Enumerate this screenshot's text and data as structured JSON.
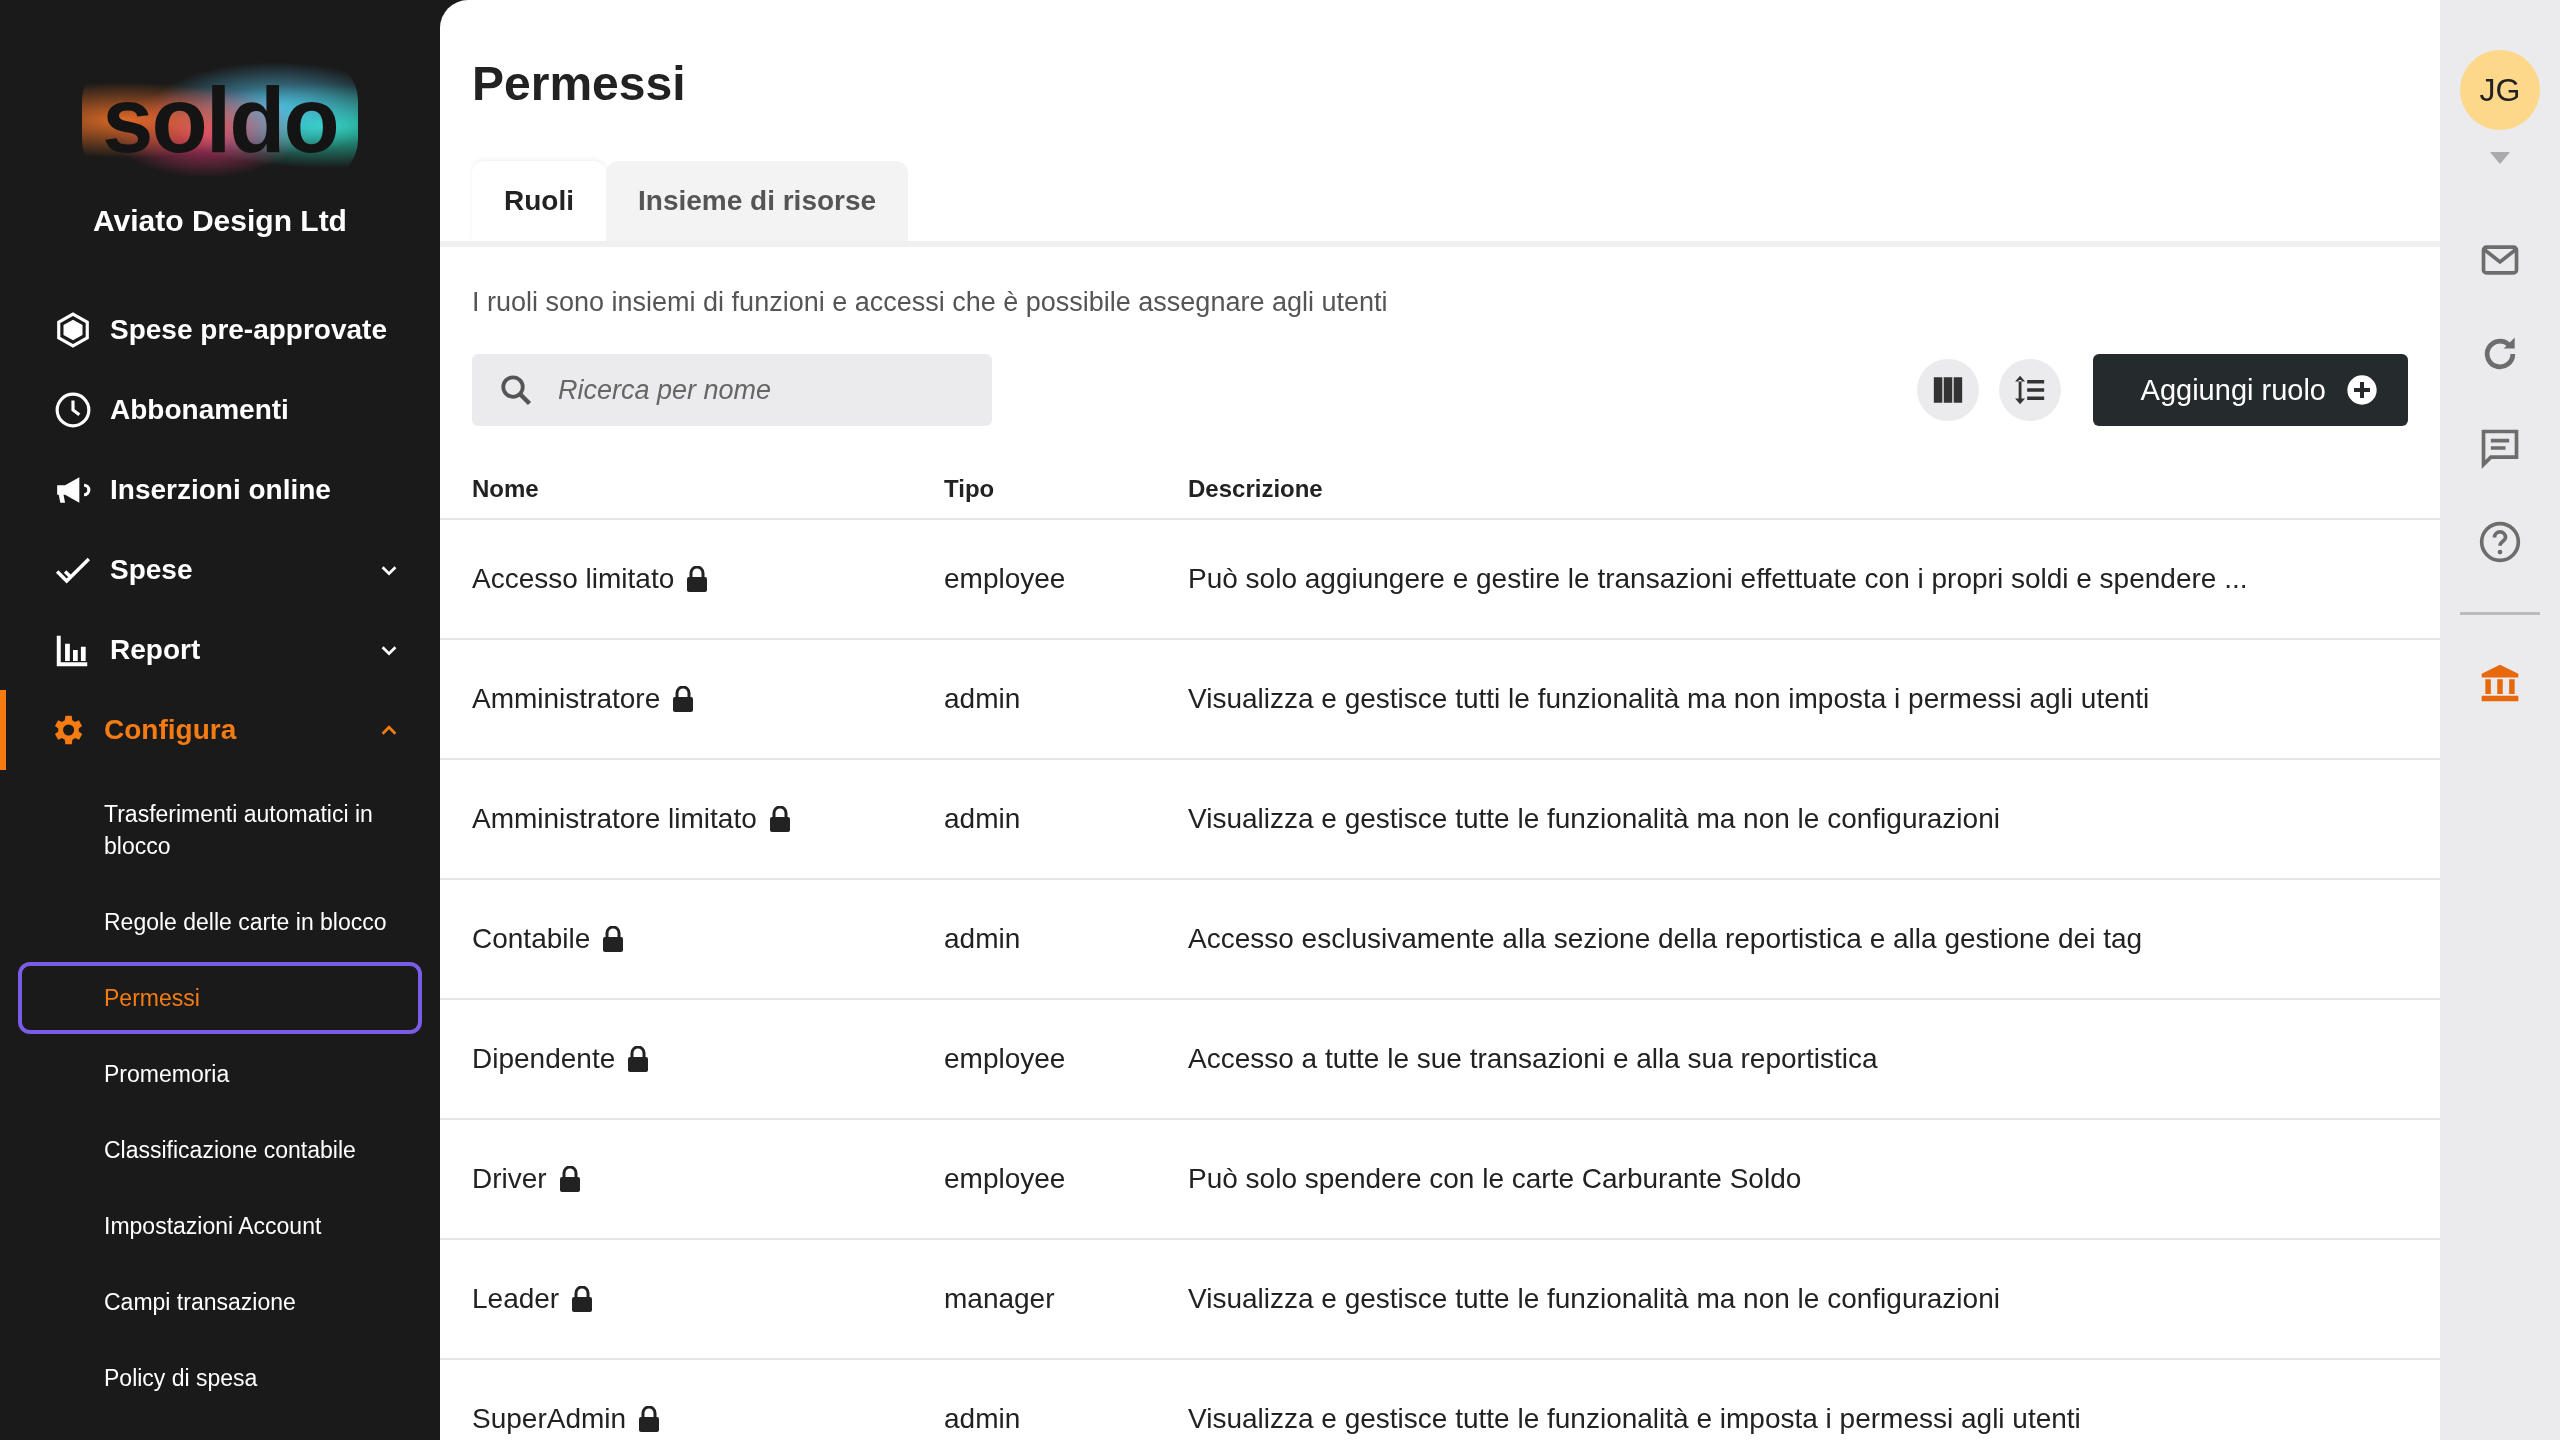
{
  "sidebar": {
    "logo": "soldo",
    "company": "Aviato Design Ltd",
    "nav": [
      {
        "kind": "hexagon",
        "label": "Spese pre-approvate",
        "active": false
      },
      {
        "kind": "clock",
        "label": "Abbonamenti",
        "active": false
      },
      {
        "kind": "megaphone",
        "label": "Inserzioni online",
        "active": false
      },
      {
        "kind": "check",
        "label": "Spese",
        "active": false,
        "expanded": false
      },
      {
        "kind": "chart",
        "label": "Report",
        "active": false,
        "expanded": false
      },
      {
        "kind": "gear",
        "label": "Configura",
        "active": true,
        "expanded": true,
        "children": [
          {
            "label": "Trasferimenti automatici in blocco",
            "selected": false
          },
          {
            "label": "Regole delle carte in blocco",
            "selected": false
          },
          {
            "label": "Permessi",
            "selected": true
          },
          {
            "label": "Promemoria",
            "selected": false
          },
          {
            "label": "Classificazione contabile",
            "selected": false
          },
          {
            "label": "Impostazioni Account",
            "selected": false
          },
          {
            "label": "Campi transazione",
            "selected": false
          },
          {
            "label": "Policy di spesa",
            "selected": false
          }
        ]
      }
    ]
  },
  "page": {
    "title": "Permessi",
    "tabs": [
      {
        "label": "Ruoli",
        "selected": true
      },
      {
        "label": "Insieme di risorse",
        "selected": false
      }
    ],
    "description": "I ruoli sono insiemi di funzioni e accessi che è possibile assegnare agli utenti",
    "search": {
      "placeholder": "Ricerca per nome"
    },
    "toolbar": [
      {
        "kind": "columns"
      },
      {
        "kind": "density"
      }
    ],
    "add_button": "Aggiungi ruolo",
    "table": {
      "columns": [
        "Nome",
        "Tipo",
        "Descrizione"
      ],
      "rows": [
        {
          "name": "Accesso limitato",
          "locked": true,
          "type": "employee",
          "description": "Può solo aggiungere e gestire le transazioni effettuate con i propri soldi e spendere ..."
        },
        {
          "name": "Amministratore",
          "locked": true,
          "type": "admin",
          "description": "Visualizza e gestisce tutti le funzionalità ma non imposta i permessi agli utenti"
        },
        {
          "name": "Amministratore limitato",
          "locked": true,
          "type": "admin",
          "description": "Visualizza e gestisce tutte le funzionalità ma non le configurazioni"
        },
        {
          "name": "Contabile",
          "locked": true,
          "type": "admin",
          "description": "Accesso esclusivamente alla sezione della reportistica e alla gestione dei tag"
        },
        {
          "name": "Dipendente",
          "locked": true,
          "type": "employee",
          "description": "Accesso a tutte le sue transazioni e alla sua reportistica"
        },
        {
          "name": "Driver",
          "locked": true,
          "type": "employee",
          "description": "Può solo spendere con le carte Carburante Soldo"
        },
        {
          "name": "Leader",
          "locked": true,
          "type": "manager",
          "description": "Visualizza e gestisce tutte le funzionalità ma non le configurazioni"
        },
        {
          "name": "SuperAdmin",
          "locked": true,
          "type": "admin",
          "description": "Visualizza e gestisce tutte le funzionalità e imposta i permessi agli utenti"
        }
      ]
    }
  },
  "rail": {
    "initials": "JG",
    "icons": [
      {
        "kind": "mail",
        "selected": false
      },
      {
        "kind": "refresh",
        "selected": false
      },
      {
        "kind": "chat",
        "selected": false
      },
      {
        "kind": "help",
        "selected": false
      },
      {
        "kind": "divider"
      },
      {
        "kind": "bank",
        "selected": true
      }
    ]
  }
}
